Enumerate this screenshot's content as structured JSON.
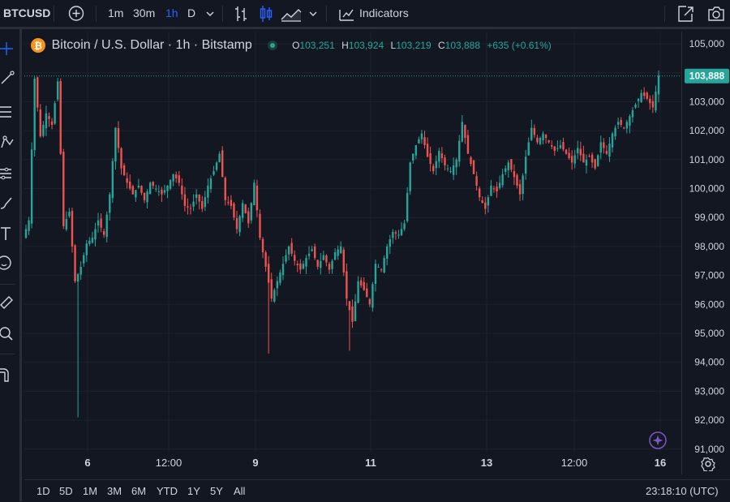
{
  "toolbar": {
    "symbol": "BTCUSD",
    "intervals": [
      "1m",
      "30m",
      "1h",
      "D"
    ],
    "active_interval": "1h",
    "indicators_label": "Indicators"
  },
  "legend": {
    "title": "Bitcoin / U.S. Dollar · 1h · Bitstamp",
    "o_label": "O",
    "o_value": "103,251",
    "h_label": "H",
    "h_value": "103,924",
    "l_label": "L",
    "l_value": "103,219",
    "c_label": "C",
    "c_value": "103,888",
    "change": "+635 (+0.61%)"
  },
  "bottom": {
    "ranges": [
      "1D",
      "5D",
      "1M",
      "3M",
      "6M",
      "YTD",
      "1Y",
      "5Y",
      "All"
    ],
    "clock": "23:18:10 (UTC)"
  },
  "colors": {
    "up": "#26a69a",
    "down": "#ef5350",
    "accent": "#2962ff",
    "bg": "#131722",
    "grid": "#1e222d"
  },
  "icons": [
    "plus-circle-icon",
    "chevron-down-icon",
    "bar-style-icon",
    "candle-style-icon",
    "area-style-icon",
    "indicators-icon",
    "snapshot-icon",
    "camera-icon",
    "crosshair-icon",
    "trendline-icon",
    "fib-icon",
    "pattern-icon",
    "forecast-icon",
    "brush-icon",
    "text-icon",
    "emoji-icon",
    "ruler-icon",
    "zoom-icon",
    "magnet-icon",
    "settings-icon",
    "sparkle-icon",
    "bitcoin-logo-icon"
  ],
  "chart_data": {
    "type": "candlestick",
    "symbol": "BTCUSD",
    "x_tick_labels": [
      "6",
      "12:00",
      "9",
      "11",
      "13",
      "12:00",
      "16"
    ],
    "y_tick_labels": [
      "105,000",
      "104,000",
      "103,000",
      "102,000",
      "101,000",
      "100,000",
      "99,000",
      "98,000",
      "97,000",
      "96,000",
      "95,000",
      "94,000",
      "93,000",
      "92,000",
      "91,000"
    ],
    "ylim": [
      90800,
      105400
    ],
    "last_price_label": "103,888",
    "last_price": 103888,
    "path": [
      98300,
      98900,
      103800,
      101800,
      102600,
      102200,
      103700,
      98700,
      99200,
      96800,
      97300,
      98100,
      98300,
      98900,
      98400,
      99800,
      102100,
      100700,
      100200,
      99800,
      100100,
      99600,
      100200,
      100000,
      99800,
      100100,
      100500,
      100200,
      99400,
      99300,
      99800,
      99300,
      100100,
      100600,
      101200,
      99600,
      99400,
      98600,
      99500,
      98800,
      100200,
      98300,
      97300,
      96200,
      96800,
      97400,
      98000,
      97500,
      97200,
      97600,
      97900,
      97300,
      97700,
      97200,
      97800,
      98000,
      96200,
      95400,
      96800,
      96500,
      96000,
      97400,
      97200,
      98000,
      98500,
      98400,
      98800,
      100900,
      101500,
      101900,
      101100,
      100600,
      101300,
      100800,
      100600,
      101000,
      102300,
      101200,
      100500,
      99700,
      99300,
      100100,
      99900,
      100500,
      100900,
      100400,
      99800,
      101100,
      102100,
      101600,
      101900,
      101600,
      101300,
      101500,
      101200,
      100900,
      101400,
      100900,
      101100,
      100700,
      101600,
      101200,
      101900,
      102300,
      102100,
      102500,
      102900,
      103300,
      103100,
      102800,
      103900
    ],
    "wick_spikes": [
      {
        "index": 9,
        "low": 92100
      },
      {
        "index": 42,
        "low": 94300
      },
      {
        "index": 56,
        "low": 94400
      }
    ]
  }
}
